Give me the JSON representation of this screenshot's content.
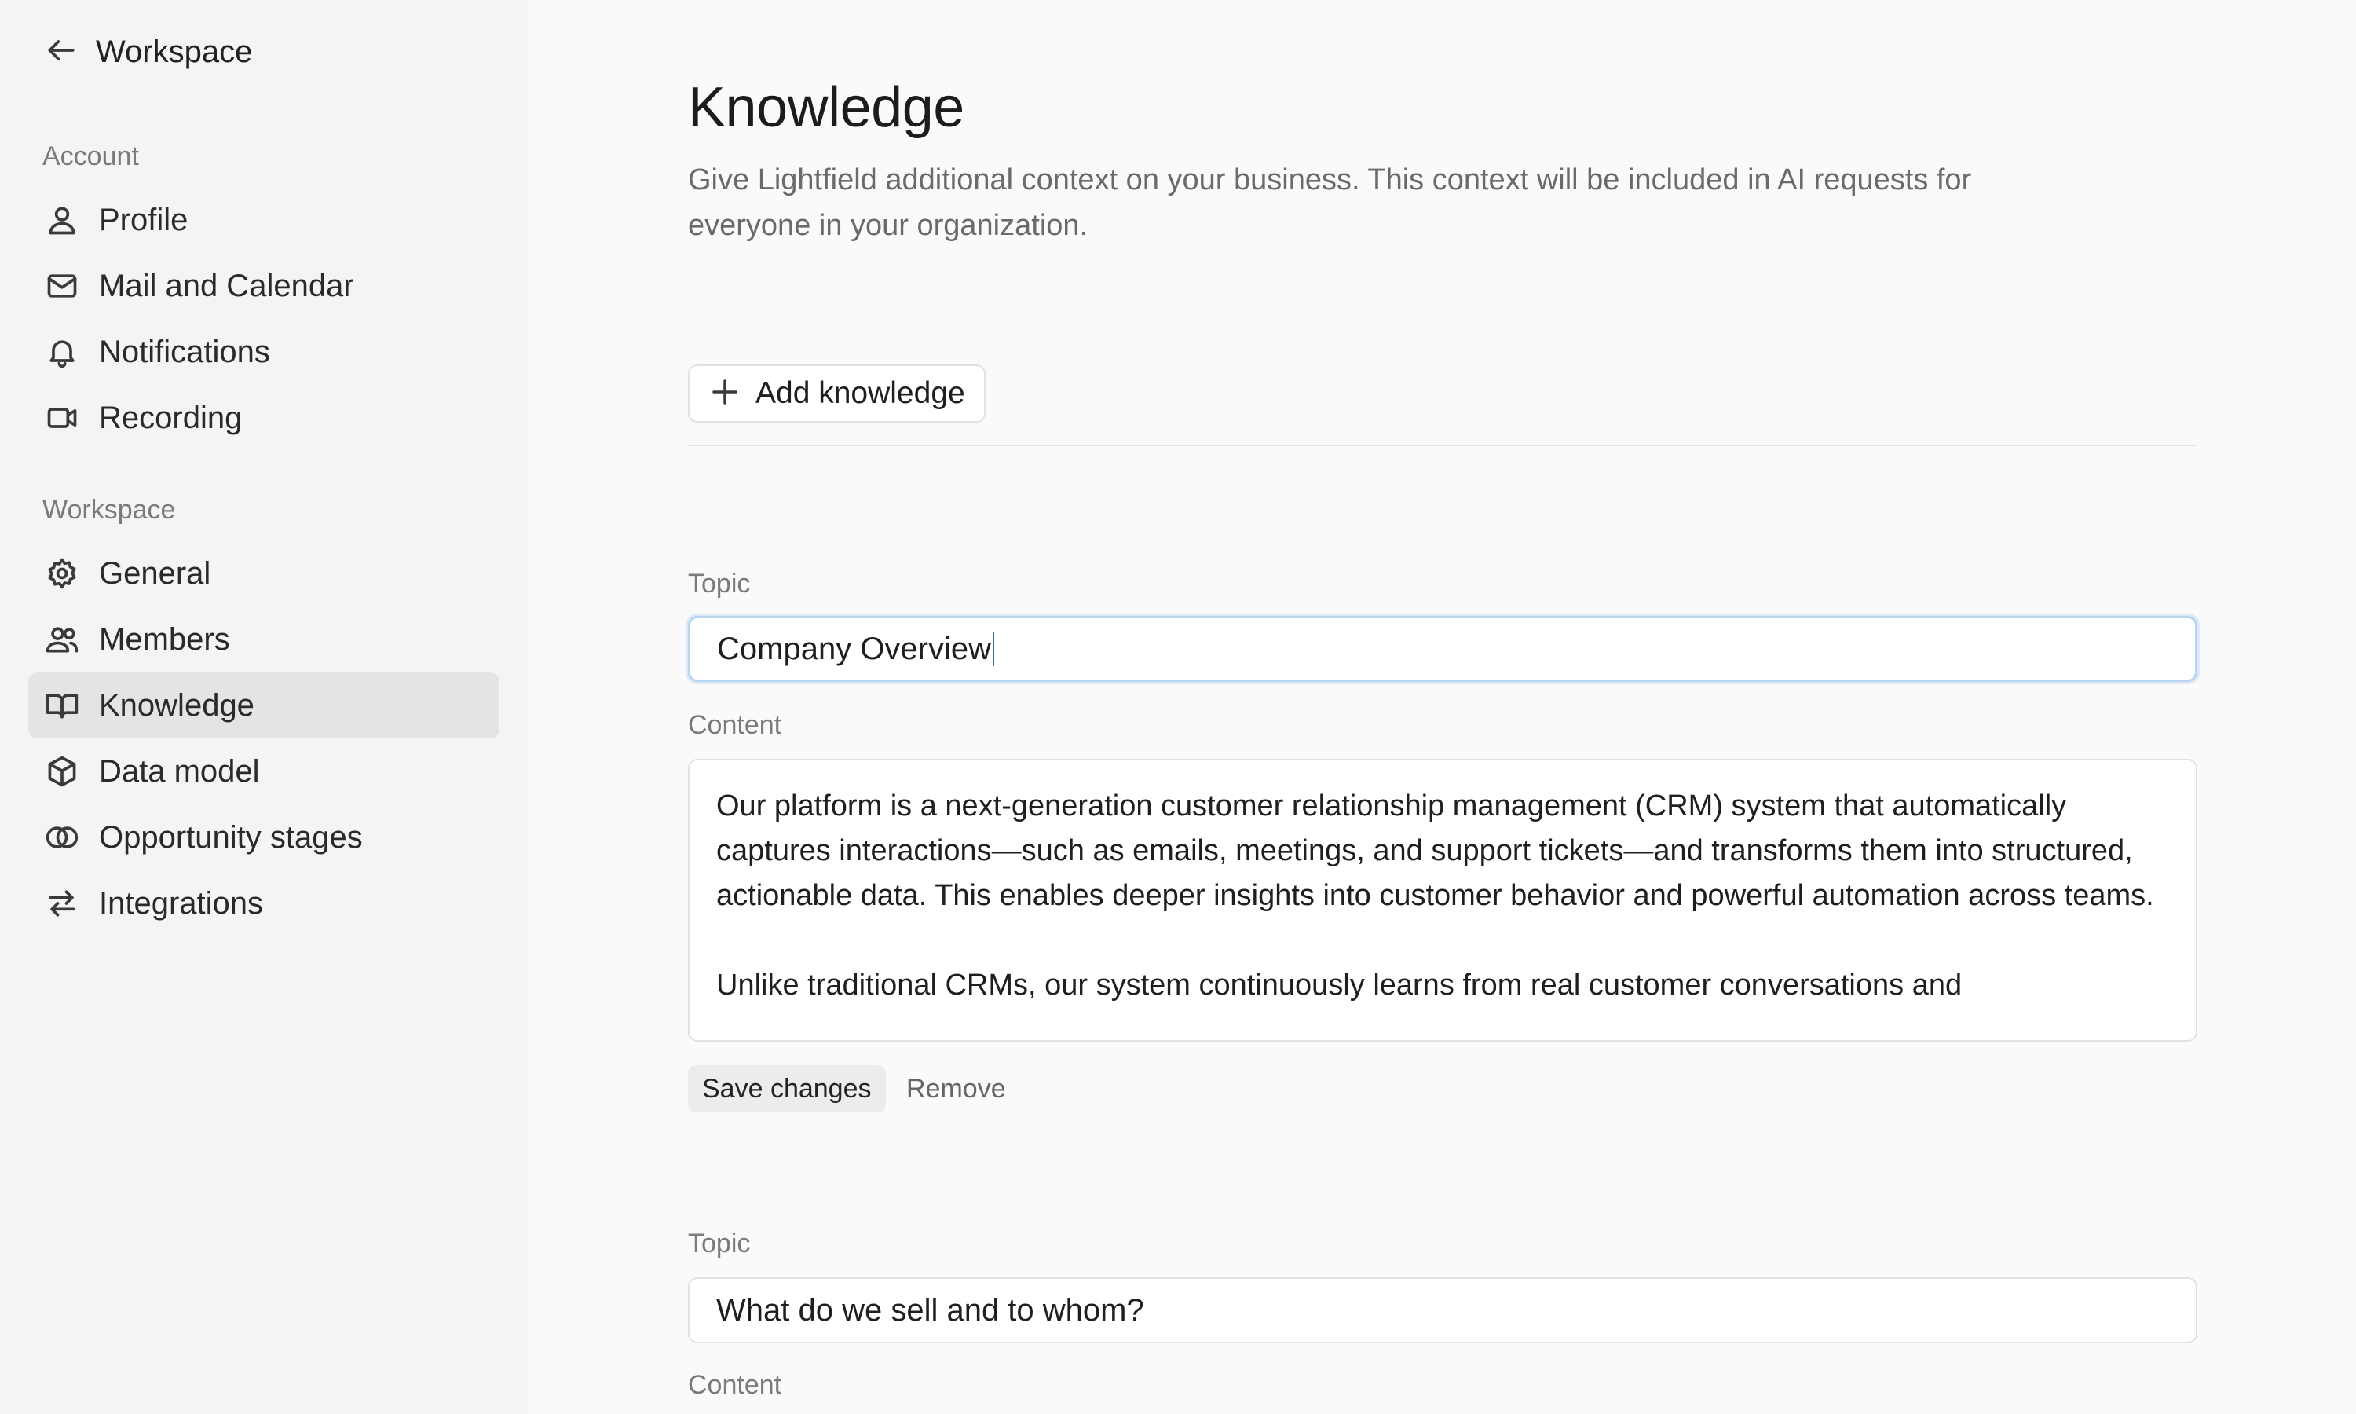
{
  "sidebar": {
    "back_label": "Workspace",
    "account_section": "Account",
    "account_items": [
      {
        "label": "Profile",
        "icon": "user-icon"
      },
      {
        "label": "Mail and Calendar",
        "icon": "mail-icon"
      },
      {
        "label": "Notifications",
        "icon": "bell-icon"
      },
      {
        "label": "Recording",
        "icon": "video-icon"
      }
    ],
    "workspace_section": "Workspace",
    "workspace_items": [
      {
        "label": "General",
        "icon": "gear-icon"
      },
      {
        "label": "Members",
        "icon": "users-icon"
      },
      {
        "label": "Knowledge",
        "icon": "book-icon",
        "active": true
      },
      {
        "label": "Data model",
        "icon": "box-icon"
      },
      {
        "label": "Opportunity stages",
        "icon": "rings-icon"
      },
      {
        "label": "Integrations",
        "icon": "arrows-icon"
      }
    ]
  },
  "main": {
    "title": "Knowledge",
    "description": "Give Lightfield additional context on your business. This context will be included in AI requests for everyone in your organization.",
    "add_button": "Add knowledge",
    "entries": [
      {
        "topic_label": "Topic",
        "topic_value": "Company Overview",
        "content_label": "Content",
        "content_paragraphs": [
          "Our platform is a next-generation customer relationship management (CRM) system that automatically captures interactions—such as emails, meetings, and support tickets—and transforms them into structured, actionable data. This enables deeper insights into customer behavior and powerful automation across teams.",
          "Unlike traditional CRMs, our system continuously learns from real customer conversations and"
        ],
        "save_label": "Save changes",
        "remove_label": "Remove"
      },
      {
        "topic_label": "Topic",
        "topic_value": "What do we sell and to whom?",
        "content_label": "Content"
      }
    ]
  },
  "colors": {
    "sidebar_bg": "#f4f4f4",
    "main_bg": "#fafafa",
    "active_item_bg": "#e4e4e4",
    "focus_ring": "#b9d4ee"
  }
}
